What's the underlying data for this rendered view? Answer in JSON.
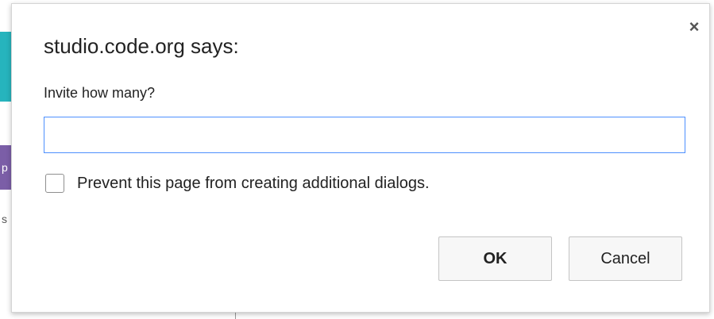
{
  "background": {
    "fragment_letter_purple": "p",
    "fragment_letter_text": "s"
  },
  "dialog": {
    "title": "studio.code.org says:",
    "close_icon": "×",
    "prompt": "Invite how many?",
    "input_value": "",
    "input_placeholder": "",
    "checkbox_label": "Prevent this page from creating additional dialogs.",
    "checkbox_checked": false,
    "ok_label": "OK",
    "cancel_label": "Cancel"
  },
  "colors": {
    "input_focus_border": "#4d90fe",
    "background_teal": "#26b4bd",
    "background_purple": "#7b5ea7"
  },
  "icons": {
    "close": "close-icon",
    "checkbox": "checkbox-icon"
  }
}
